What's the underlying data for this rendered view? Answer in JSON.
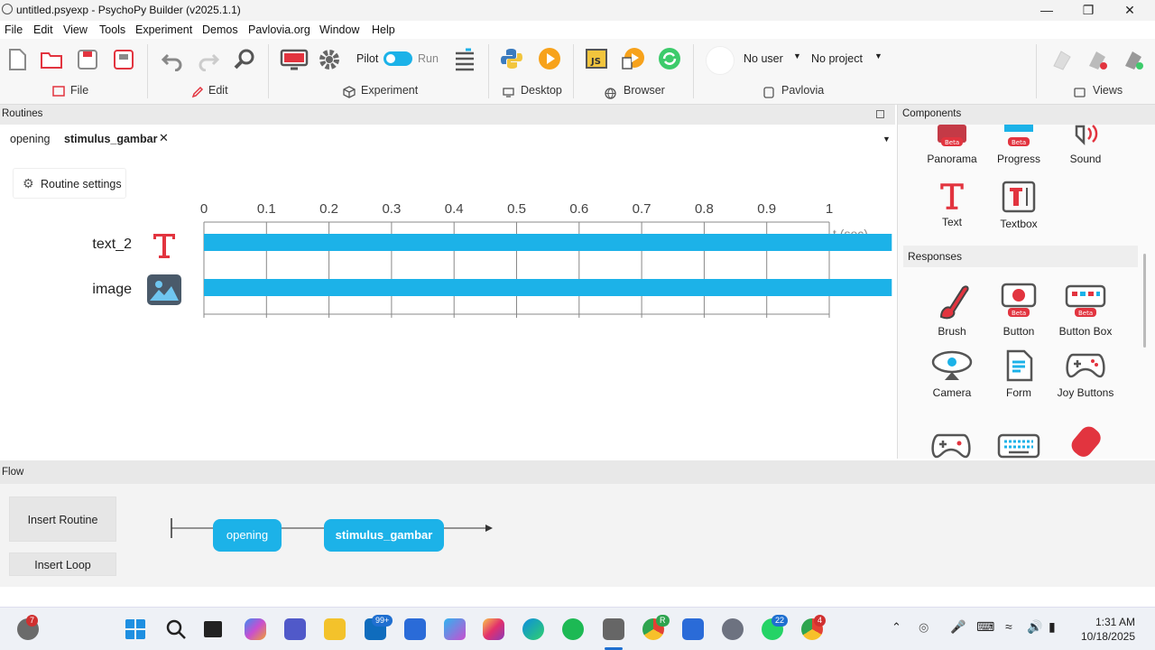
{
  "window": {
    "title": "untitled.psyexp - PsychoPy Builder (v2025.1.1)"
  },
  "menu": [
    "File",
    "Edit",
    "View",
    "Tools",
    "Experiment",
    "Demos",
    "Pavlovia.org",
    "Window",
    "Help"
  ],
  "ribbon": {
    "pilot_label": "Pilot",
    "run_label": "Run",
    "user_label": "No user",
    "project_label": "No project",
    "groups": {
      "file": "File",
      "edit": "Edit",
      "experiment": "Experiment",
      "desktop": "Desktop",
      "browser": "Browser",
      "pavlovia": "Pavlovia",
      "views": "Views"
    }
  },
  "routines": {
    "header": "Routines",
    "tabs": [
      "opening",
      "stimulus_gambar"
    ],
    "active_tab": "stimulus_gambar",
    "settings_label": "Routine settings",
    "timeline": {
      "ticks": [
        "0",
        "0.1",
        "0.2",
        "0.3",
        "0.4",
        "0.5",
        "0.6",
        "0.7",
        "0.8",
        "0.9",
        "1"
      ],
      "tick_values": [
        0,
        0.1,
        0.2,
        0.3,
        0.4,
        0.5,
        0.6,
        0.7,
        0.8,
        0.9,
        1.0
      ],
      "axis_unit": "t (sec)",
      "components": [
        {
          "name": "text_2",
          "icon": "text-icon",
          "start": 0,
          "stop": 1.1
        },
        {
          "name": "image",
          "icon": "image-icon",
          "start": 0,
          "stop": 1.1
        }
      ]
    }
  },
  "components": {
    "header": "Components",
    "top_items": [
      {
        "label": "Panorama",
        "badge": "Beta"
      },
      {
        "label": "Progress",
        "badge": "Beta"
      },
      {
        "label": "Sound",
        "badge": ""
      },
      {
        "label": "Text",
        "badge": ""
      },
      {
        "label": "Textbox",
        "badge": ""
      }
    ],
    "responses_header": "Responses",
    "responses": [
      {
        "label": "Brush",
        "badge": ""
      },
      {
        "label": "Button",
        "badge": "Beta"
      },
      {
        "label": "Button Box",
        "badge": "Beta"
      },
      {
        "label": "Camera",
        "badge": ""
      },
      {
        "label": "Form",
        "badge": ""
      },
      {
        "label": "Joy Buttons",
        "badge": ""
      }
    ]
  },
  "flow": {
    "header": "Flow",
    "insert_routine": "Insert Routine",
    "insert_loop": "Insert Loop",
    "routines": [
      "opening",
      "stimulus_gambar"
    ]
  },
  "taskbar": {
    "time": "1:31 AM",
    "date": "10/18/2025",
    "badges": {
      "app_left": "7",
      "mail": "99+",
      "chrome_r": "R",
      "whatsapp": "22",
      "chrome_2": "4"
    }
  },
  "colors": {
    "accent": "#1cb2e8",
    "psychopy_red": "#e2343f",
    "titlebar": "#f3f3f3"
  }
}
